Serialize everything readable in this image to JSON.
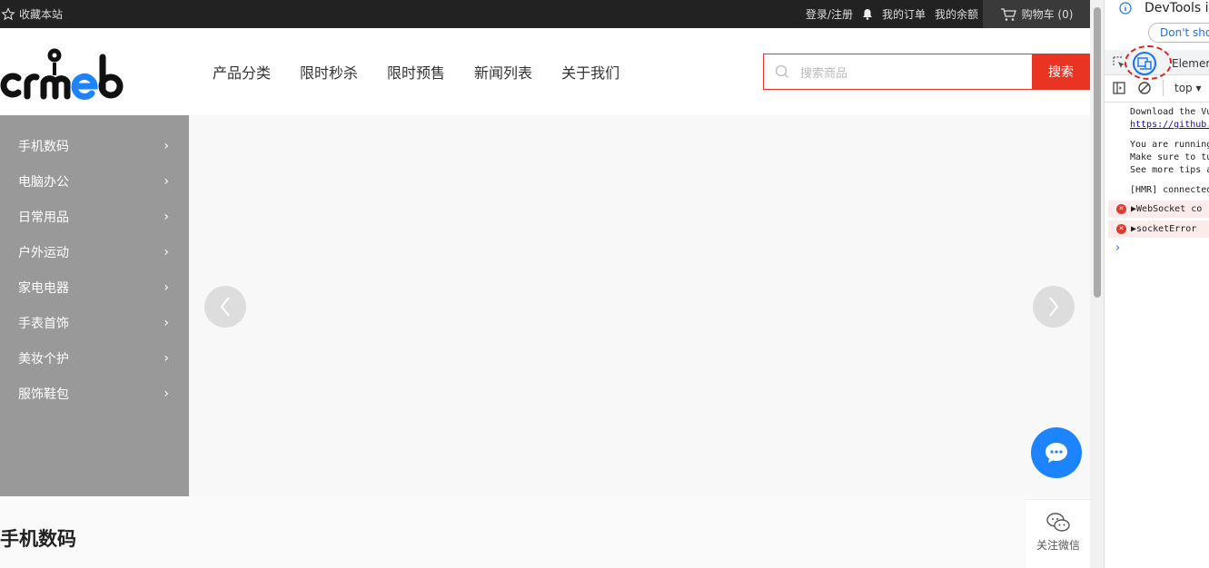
{
  "topbar": {
    "favorite": "收藏本站",
    "links": [
      "登录/注册",
      "我的订单",
      "我的余额"
    ],
    "cart": "购物车 (0)"
  },
  "header": {
    "logo": "crmeb",
    "nav": [
      "产品分类",
      "限时秒杀",
      "限时预售",
      "新闻列表",
      "关于我们"
    ],
    "search_placeholder": "搜索商品",
    "search_button": "搜索"
  },
  "categories": [
    "手机数码",
    "电脑办公",
    "日常用品",
    "户外运动",
    "家电电器",
    "手表首饰",
    "美妆个护",
    "服饰鞋包"
  ],
  "section_title": "手机数码",
  "float": {
    "wechat": "关注微信"
  },
  "devtools": {
    "banner": "DevTools is",
    "dont_show": "Don't sho",
    "tab": "Elemer",
    "context": "top",
    "console": [
      "Download the Vu",
      "https://github.",
      "You are running",
      "Make sure to tu",
      "See more tips a",
      "[HMR] connected"
    ],
    "errors": [
      "WebSocket co",
      "socketError"
    ]
  },
  "colors": {
    "accent": "#e93323",
    "chat": "#1c84ff",
    "sidebar": "#999999",
    "topbar": "#222222"
  }
}
